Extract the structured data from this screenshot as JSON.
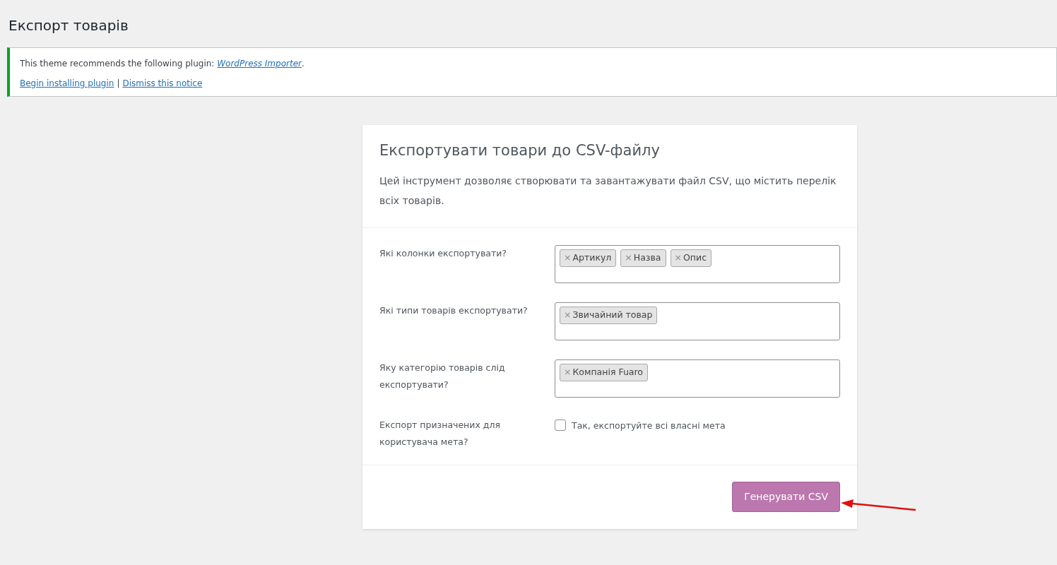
{
  "page_title": "Експорт товарів",
  "notice": {
    "text_before": "This theme recommends the following plugin: ",
    "plugin_link": "WordPress Importer",
    "text_after": ".",
    "actions": [
      "Begin installing plugin",
      "Dismiss this notice"
    ],
    "separator": "|"
  },
  "card": {
    "title": "Експортувати товари до CSV-файлу",
    "description": "Цей інструмент дозволяє створювати та завантажувати файл CSV, що містить перелік всіх товарів.",
    "fields": [
      {
        "kind": "tags",
        "label": "Які колонки експортувати?",
        "tags": [
          "Артикул",
          "Назва",
          "Опис"
        ]
      },
      {
        "kind": "tags",
        "label": "Які типи товарів експортувати?",
        "tags": [
          "Звичайний товар"
        ]
      },
      {
        "kind": "tags",
        "label": "Яку категорію товарів слід експортувати?",
        "tags": [
          "Компанія Fuaro"
        ]
      },
      {
        "kind": "checkbox",
        "label": "Експорт призначених для користувача мета?",
        "option": "Так, експортуйте всі власні мета",
        "checked": false
      }
    ],
    "remove_glyph": "×",
    "button": "Генерувати CSV"
  },
  "annotation_arrow": true
}
